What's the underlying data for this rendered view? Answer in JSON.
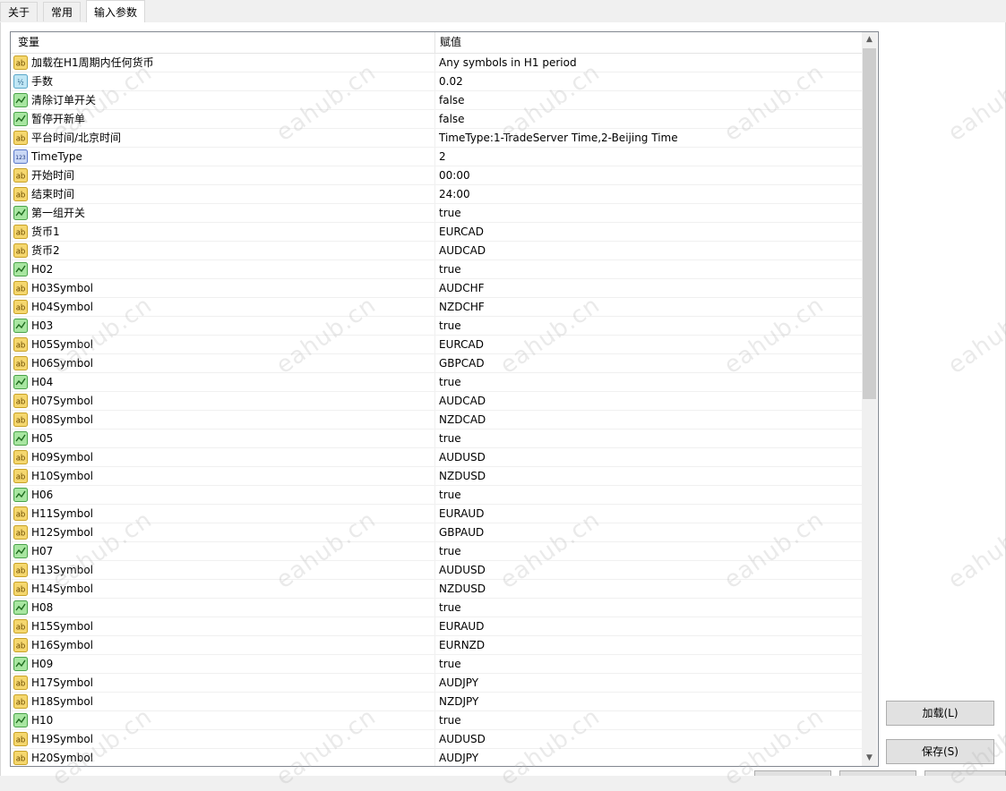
{
  "tabs": [
    {
      "label": "关于",
      "active": false
    },
    {
      "label": "常用",
      "active": false
    },
    {
      "label": "输入参数",
      "active": true
    }
  ],
  "grid": {
    "header": {
      "variable": "变量",
      "value": "赋值"
    },
    "rows": [
      {
        "icon": "string-icon",
        "name": "加载在H1周期内任何货币",
        "value": "Any symbols in H1 period"
      },
      {
        "icon": "double-icon",
        "name": "手数",
        "value": "0.02"
      },
      {
        "icon": "bool-icon",
        "name": "清除订单开关",
        "value": "false"
      },
      {
        "icon": "bool-icon",
        "name": "暂停开新单",
        "value": "false"
      },
      {
        "icon": "string-icon",
        "name": "平台时间/北京时间",
        "value": "TimeType:1-TradeServer Time,2-Beijing Time"
      },
      {
        "icon": "int-icon",
        "name": "TimeType",
        "value": "2"
      },
      {
        "icon": "string-icon",
        "name": "开始时间",
        "value": "00:00"
      },
      {
        "icon": "string-icon",
        "name": "结束时间",
        "value": "24:00"
      },
      {
        "icon": "bool-icon",
        "name": "第一组开关",
        "value": "true"
      },
      {
        "icon": "string-icon",
        "name": "货币1",
        "value": "EURCAD"
      },
      {
        "icon": "string-icon",
        "name": "货币2",
        "value": "AUDCAD"
      },
      {
        "icon": "bool-icon",
        "name": "H02",
        "value": "true"
      },
      {
        "icon": "string-icon",
        "name": "H03Symbol",
        "value": "AUDCHF"
      },
      {
        "icon": "string-icon",
        "name": "H04Symbol",
        "value": "NZDCHF"
      },
      {
        "icon": "bool-icon",
        "name": "H03",
        "value": "true"
      },
      {
        "icon": "string-icon",
        "name": "H05Symbol",
        "value": "EURCAD"
      },
      {
        "icon": "string-icon",
        "name": "H06Symbol",
        "value": "GBPCAD"
      },
      {
        "icon": "bool-icon",
        "name": "H04",
        "value": "true"
      },
      {
        "icon": "string-icon",
        "name": "H07Symbol",
        "value": "AUDCAD"
      },
      {
        "icon": "string-icon",
        "name": "H08Symbol",
        "value": "NZDCAD"
      },
      {
        "icon": "bool-icon",
        "name": "H05",
        "value": "true"
      },
      {
        "icon": "string-icon",
        "name": "H09Symbol",
        "value": "AUDUSD"
      },
      {
        "icon": "string-icon",
        "name": "H10Symbol",
        "value": "NZDUSD"
      },
      {
        "icon": "bool-icon",
        "name": "H06",
        "value": "true"
      },
      {
        "icon": "string-icon",
        "name": "H11Symbol",
        "value": "EURAUD"
      },
      {
        "icon": "string-icon",
        "name": "H12Symbol",
        "value": "GBPAUD"
      },
      {
        "icon": "bool-icon",
        "name": "H07",
        "value": "true"
      },
      {
        "icon": "string-icon",
        "name": "H13Symbol",
        "value": "AUDUSD"
      },
      {
        "icon": "string-icon",
        "name": "H14Symbol",
        "value": "NZDUSD"
      },
      {
        "icon": "bool-icon",
        "name": "H08",
        "value": "true"
      },
      {
        "icon": "string-icon",
        "name": "H15Symbol",
        "value": "EURAUD"
      },
      {
        "icon": "string-icon",
        "name": "H16Symbol",
        "value": "EURNZD"
      },
      {
        "icon": "bool-icon",
        "name": "H09",
        "value": "true"
      },
      {
        "icon": "string-icon",
        "name": "H17Symbol",
        "value": "AUDJPY"
      },
      {
        "icon": "string-icon",
        "name": "H18Symbol",
        "value": "NZDJPY"
      },
      {
        "icon": "bool-icon",
        "name": "H10",
        "value": "true"
      },
      {
        "icon": "string-icon",
        "name": "H19Symbol",
        "value": "AUDUSD"
      },
      {
        "icon": "string-icon",
        "name": "H20Symbol",
        "value": "AUDJPY"
      }
    ]
  },
  "buttons": {
    "load": "加载(L)",
    "save": "保存(S)"
  },
  "watermark": "eahub.cn"
}
